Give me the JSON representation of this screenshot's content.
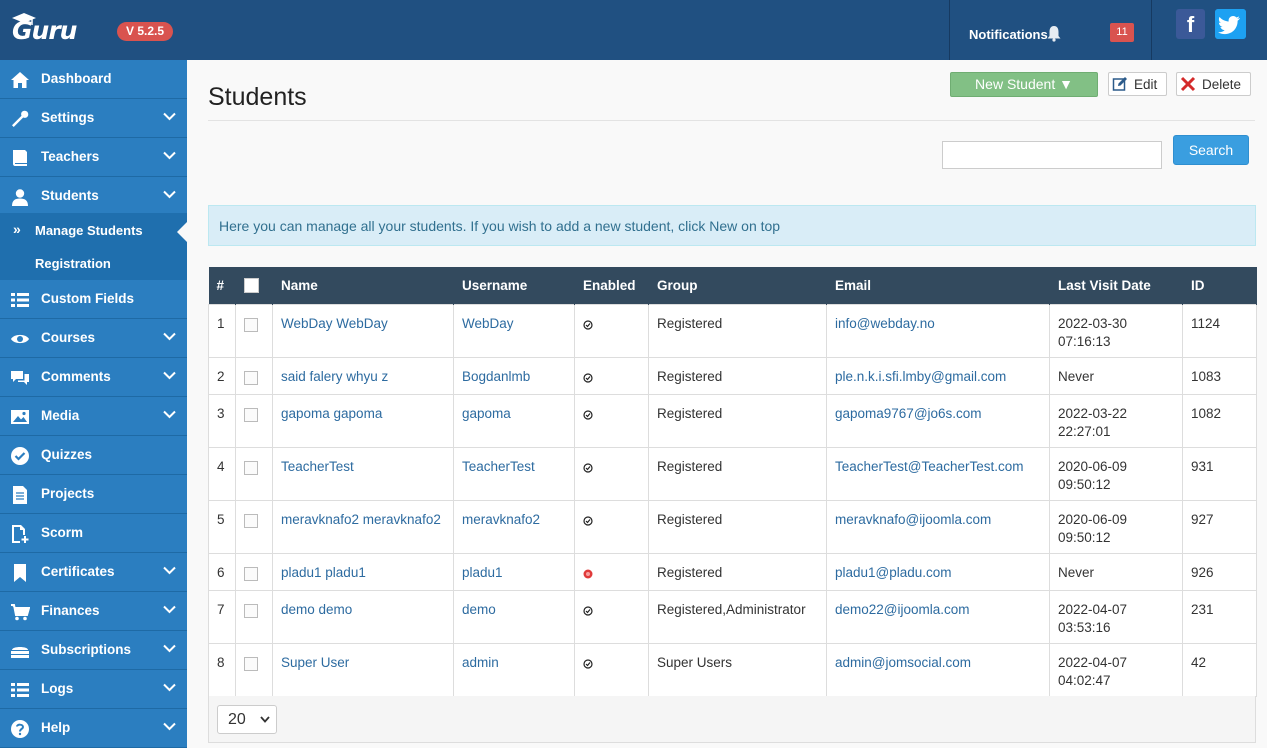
{
  "header": {
    "logo_text": "Guru",
    "version": "V 5.2.5",
    "notifications_label": "Notifications",
    "notifications_count": "11",
    "facebook_icon": "facebook-icon",
    "twitter_icon": "twitter-icon",
    "bg_color": "#205081"
  },
  "sidebar": {
    "items": [
      {
        "label": "Dashboard",
        "icon": "home-icon"
      },
      {
        "label": "Settings",
        "icon": "wrench-icon"
      },
      {
        "label": "Teachers",
        "icon": "book-icon"
      },
      {
        "label": "Students",
        "icon": "user-icon"
      },
      {
        "label": "Custom Fields",
        "icon": "list-icon"
      },
      {
        "label": "Courses",
        "icon": "eye-icon"
      },
      {
        "label": "Comments",
        "icon": "comments-icon"
      },
      {
        "label": "Media",
        "icon": "image-icon"
      },
      {
        "label": "Quizzes",
        "icon": "check-circle-icon"
      },
      {
        "label": "Projects",
        "icon": "document-icon"
      },
      {
        "label": "Scorm",
        "icon": "file-add-icon"
      },
      {
        "label": "Certificates",
        "icon": "bookmark-icon"
      },
      {
        "label": "Finances",
        "icon": "cart-icon"
      },
      {
        "label": "Subscriptions",
        "icon": "stack-icon"
      },
      {
        "label": "Logs",
        "icon": "list-icon"
      },
      {
        "label": "Help",
        "icon": "question-icon"
      }
    ],
    "sub_items": [
      {
        "label": "Manage Students",
        "marker": "»"
      },
      {
        "label": "Registration"
      }
    ]
  },
  "main": {
    "title": "Students",
    "new_button": "New Student ▼",
    "edit_button": "Edit",
    "delete_button": "Delete",
    "search_placeholder": "",
    "search_button": "Search",
    "info_text": "Here you can manage all your students. If you wish to add a new student, click New on top"
  },
  "table": {
    "columns": [
      "#",
      "",
      "Name",
      "Username",
      "Enabled",
      "Group",
      "Email",
      "Last Visit Date",
      "ID"
    ],
    "rows": [
      {
        "num": "1",
        "name": "WebDay WebDay",
        "username": "WebDay",
        "enabled": true,
        "group": "Registered",
        "email": "info@webday.no",
        "date": "2022-03-30",
        "time": "07:16:13",
        "id": "1124"
      },
      {
        "num": "2",
        "name": "said falery whyu z",
        "username": "Bogdanlmb",
        "enabled": true,
        "group": "Registered",
        "email": "ple.n.k.i.sfi.lmby@gmail.com",
        "date": "Never",
        "time": "",
        "id": "1083"
      },
      {
        "num": "3",
        "name": "gapoma gapoma",
        "username": "gapoma",
        "enabled": true,
        "group": "Registered",
        "email": "gapoma9767@jo6s.com",
        "date": "2022-03-22",
        "time": "22:27:01",
        "id": "1082"
      },
      {
        "num": "4",
        "name": "TeacherTest",
        "username": "TeacherTest",
        "enabled": true,
        "group": "Registered",
        "email": "TeacherTest@TeacherTest.com",
        "date": "2020-06-09",
        "time": "09:50:12",
        "id": "931"
      },
      {
        "num": "5",
        "name": "meravknafo2 meravknafo2",
        "username": "meravknafo2",
        "enabled": true,
        "group": "Registered",
        "email": "meravknafo@ijoomla.com",
        "date": "2020-06-09",
        "time": "09:50:12",
        "id": "927"
      },
      {
        "num": "6",
        "name": "pladu1 pladu1",
        "username": "pladu1",
        "enabled": false,
        "group": "Registered",
        "email": "pladu1@pladu.com",
        "date": "Never",
        "time": "",
        "id": "926"
      },
      {
        "num": "7",
        "name": "demo demo",
        "username": "demo",
        "enabled": true,
        "group": "Registered,Administrator",
        "email": "demo22@ijoomla.com",
        "date": "2022-04-07",
        "time": "03:53:16",
        "id": "231"
      },
      {
        "num": "8",
        "name": "Super User",
        "username": "admin",
        "enabled": true,
        "group": "Super Users",
        "email": "admin@jomsocial.com",
        "date": "2022-04-07",
        "time": "04:02:47",
        "id": "42"
      }
    ],
    "page_size": "20"
  }
}
